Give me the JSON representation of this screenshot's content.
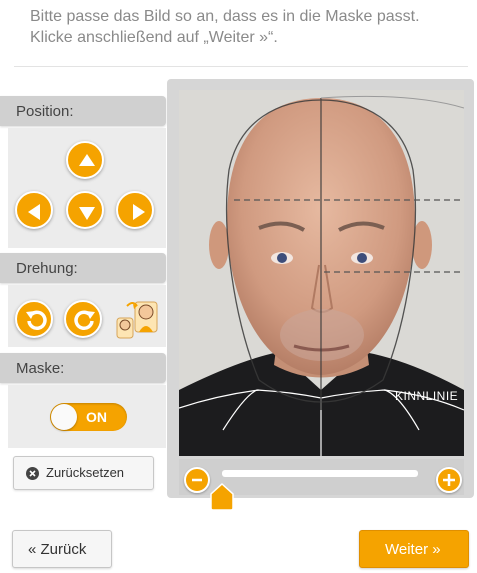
{
  "instruction": "Bitte passe das Bild so an, dass es in die Maske passt. Klicke anschließend auf „Weiter »“.",
  "sections": {
    "position": "Position:",
    "rotation": "Drehung:",
    "mask": "Maske:"
  },
  "mask_toggle": {
    "label": "ON",
    "state": "on"
  },
  "reset_label": "Zurücksetzen",
  "overlay": {
    "chin_line_label": "KINNLINIE"
  },
  "zoom_slider": {
    "level": 0
  },
  "nav": {
    "back_label": "« Zurück",
    "next_label": "Weiter »"
  },
  "colors": {
    "accent": "#f5a300",
    "panel": "#ececec",
    "panel_header": "#d0d0d0"
  },
  "icons": [
    "arrow-up-icon",
    "arrow-left-icon",
    "arrow-down-icon",
    "arrow-right-icon",
    "rotate-left-icon",
    "rotate-right-icon",
    "mirror-face-icon",
    "close-circle-icon",
    "zoom-out-icon",
    "zoom-in-icon"
  ]
}
